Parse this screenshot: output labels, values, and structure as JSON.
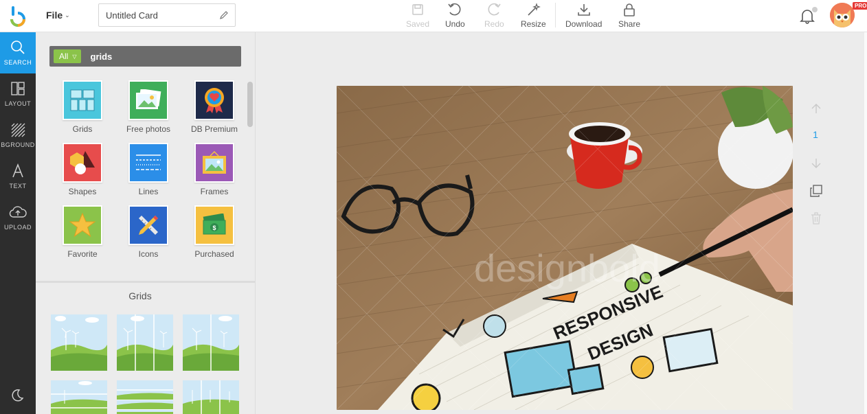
{
  "topbar": {
    "file_label": "File",
    "title_value": "Untitled Card",
    "buttons": {
      "saved": "Saved",
      "undo": "Undo",
      "redo": "Redo",
      "resize": "Resize",
      "download": "Download",
      "share": "Share"
    },
    "pro_badge": "PRO"
  },
  "leftnav": {
    "items": [
      {
        "label": "SEARCH",
        "icon": "search-icon"
      },
      {
        "label": "LAYOUT",
        "icon": "layout-icon"
      },
      {
        "label": "BGROUND",
        "icon": "background-icon"
      },
      {
        "label": "TEXT",
        "icon": "text-icon"
      },
      {
        "label": "UPLOAD",
        "icon": "upload-icon"
      }
    ],
    "theme_icon": "moon-icon"
  },
  "panel": {
    "filter_label": "All",
    "search_value": "grids",
    "categories": [
      {
        "label": "Grids",
        "icon": "grids-icon"
      },
      {
        "label": "Free photos",
        "icon": "photos-icon"
      },
      {
        "label": "DB Premium",
        "icon": "premium-badge-icon"
      },
      {
        "label": "Shapes",
        "icon": "shapes-icon"
      },
      {
        "label": "Lines",
        "icon": "lines-icon"
      },
      {
        "label": "Frames",
        "icon": "frames-icon"
      },
      {
        "label": "Favorite",
        "icon": "star-icon"
      },
      {
        "label": "Icons",
        "icon": "pencil-ruler-icon"
      },
      {
        "label": "Purchased",
        "icon": "money-icon"
      }
    ],
    "section_title": "Grids"
  },
  "canvas": {
    "page_number": "1",
    "watermark": "designbold"
  },
  "colors": {
    "accent": "#1e9be6",
    "nav_bg": "#2d2d2d",
    "filter_green": "#8bc34a"
  }
}
